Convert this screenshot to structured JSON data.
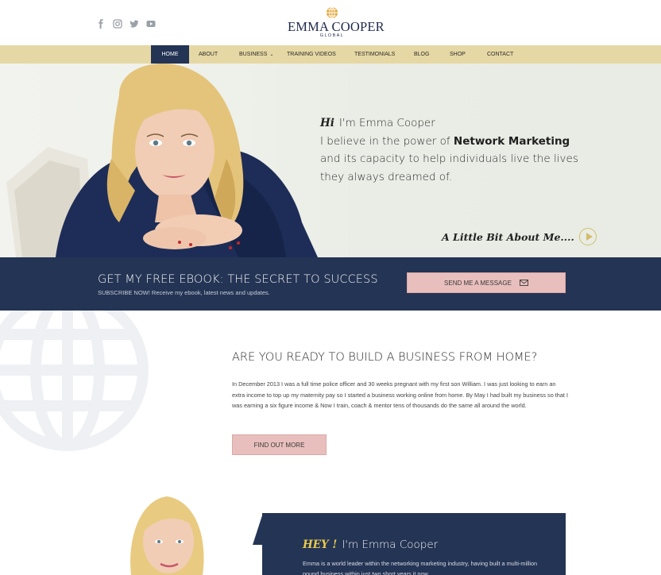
{
  "header": {
    "social_icons": [
      "facebook-icon",
      "instagram-icon",
      "twitter-icon",
      "youtube-icon"
    ],
    "logo_name": "EMMA COOPER",
    "logo_sub": "GLOBAL"
  },
  "nav": {
    "items": [
      {
        "label": "HOME",
        "active": true
      },
      {
        "label": "ABOUT"
      },
      {
        "label": "BUSINESS",
        "has_dropdown": true
      },
      {
        "label": "TRAINING VIDEOS"
      },
      {
        "label": "TESTIMONIALS"
      },
      {
        "label": "BLOG"
      },
      {
        "label": "SHOP"
      },
      {
        "label": "CONTACT"
      }
    ]
  },
  "hero": {
    "hi": "Hi",
    "name": "I'm Emma Cooper",
    "line1_pre": "I believe in the power of ",
    "line1_bold": "Network Marketing",
    "line2": "and its capacity to help individuals live the lives",
    "line3": "they always dreamed of.",
    "about_link": "A Little Bit About Me...."
  },
  "ebook": {
    "title": "GET MY FREE EBOOK: THE SECRET TO SUCCESS",
    "subtitle": "SUBSCRIBE NOW! Receive my ebook, latest news and updates.",
    "button": "SEND ME A MESSAGE"
  },
  "section2": {
    "title": "ARE YOU READY TO BUILD A BUSINESS FROM HOME?",
    "body": "In December 2013 I was a full time police officer and 30 weeks pregnant with my first son William. I was just looking to earn an extra income to top up my maternity pay so I started a business working online from home. By May I had built my business so that I was earning a six figure income & Now I train, coach & mentor tens of thousands do the same all around the world.",
    "button": "FIND OUT MORE"
  },
  "section3": {
    "hey": "HEY !",
    "name": "I'm Emma Cooper",
    "body": "Emma is a world leader within the networking marketing industry, having built a multi-million pound business within just two short years it now"
  },
  "colors": {
    "navy": "#243455",
    "gold_nav": "#e6d8a4",
    "pink_button": "#e8bfbd",
    "accent_gold": "#d4bd6a"
  }
}
